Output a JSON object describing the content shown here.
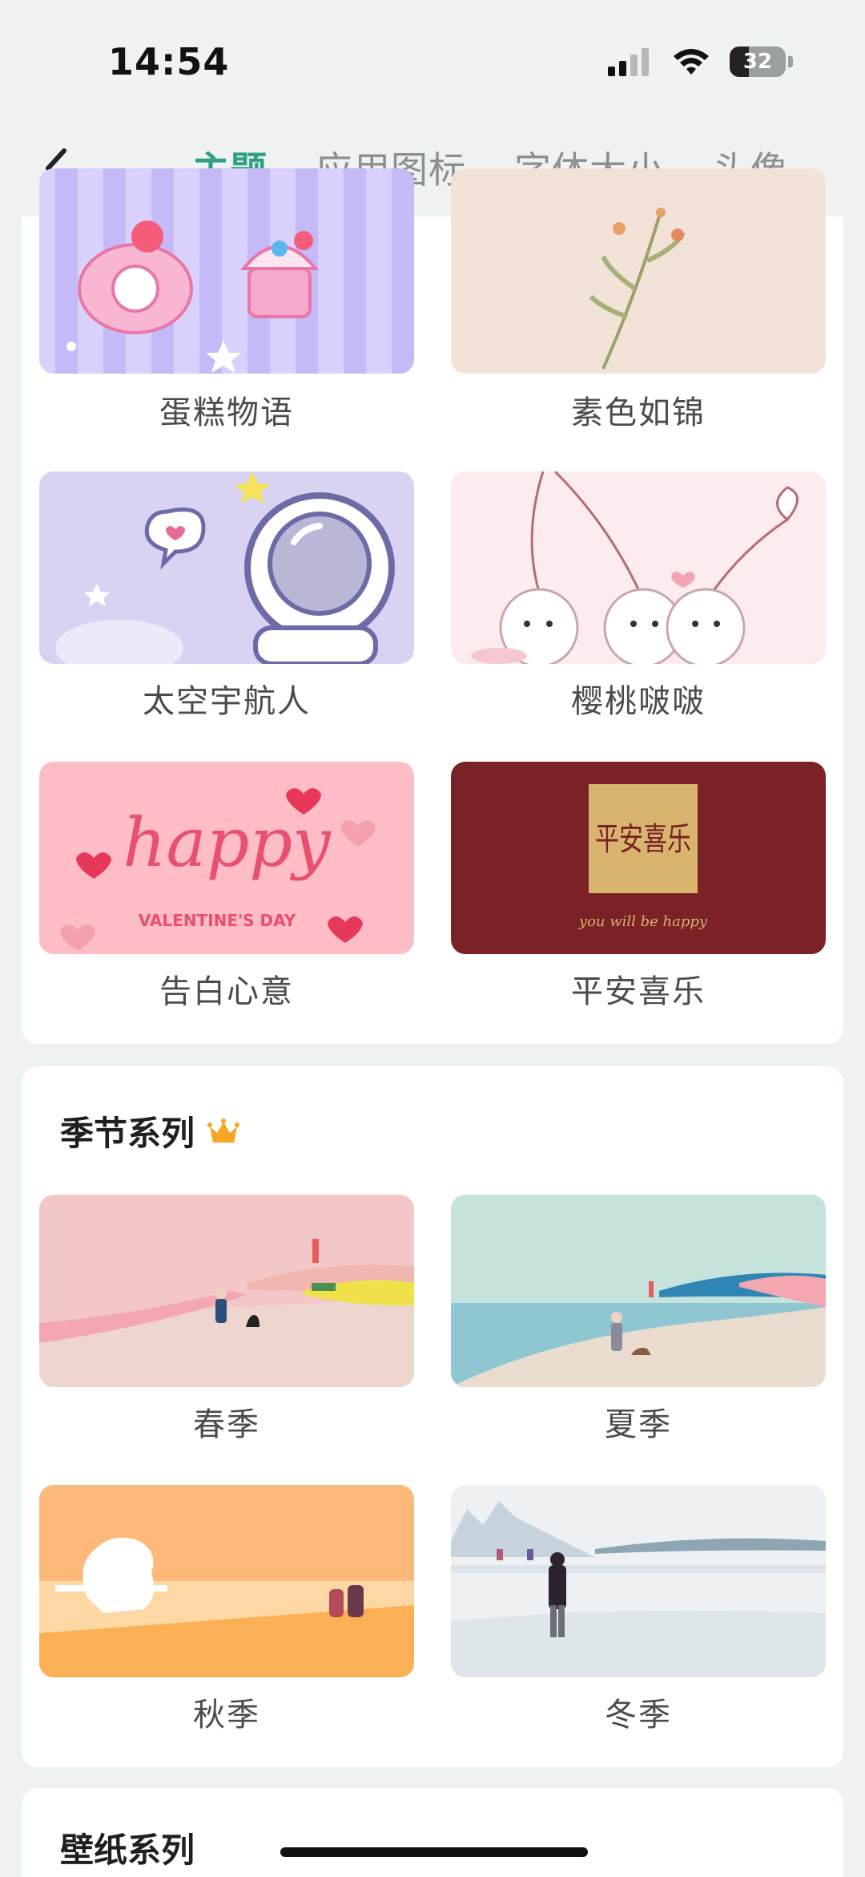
{
  "status_bar": {
    "time": "14:54",
    "battery": "32",
    "icons": [
      "signal-icon",
      "wifi-icon",
      "battery-icon"
    ]
  },
  "nav": {
    "back_icon": "chevron-left-icon",
    "tabs": [
      {
        "label": "主题",
        "active": true
      },
      {
        "label": "应用图标",
        "active": false
      },
      {
        "label": "字体大小",
        "active": false
      },
      {
        "label": "头像",
        "active": false
      }
    ]
  },
  "themes": [
    {
      "label": "蛋糕物语"
    },
    {
      "label": "素色如锦"
    },
    {
      "label": "太空宇航人"
    },
    {
      "label": "樱桃啵啵"
    },
    {
      "label": "告白心意",
      "art_text": "happy",
      "art_subtext": "VALENTINE'S DAY"
    },
    {
      "label": "平安喜乐",
      "art_text": "平安喜乐",
      "art_subtext": "you will be happy"
    }
  ],
  "season_section": {
    "title": "季节系列",
    "badge_icon": "crown-icon",
    "items": [
      {
        "label": "春季"
      },
      {
        "label": "夏季"
      },
      {
        "label": "秋季"
      },
      {
        "label": "冬季"
      }
    ]
  },
  "wallpaper_section": {
    "title": "壁纸系列"
  },
  "colors": {
    "accent": "#2fa084",
    "tab_inactive": "#8b8f8f",
    "background": "#eef3f2",
    "crown": "#f5a623"
  }
}
